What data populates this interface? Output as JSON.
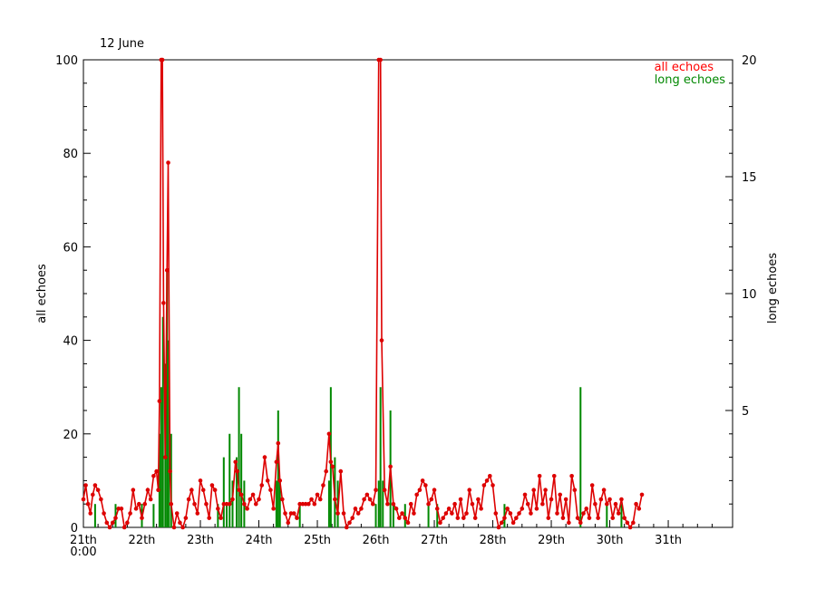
{
  "chart_data": {
    "type": "line",
    "title": "12 June",
    "ylabel_left": "all echoes",
    "ylabel_right": "long echoes",
    "ylim_left": [
      0,
      100
    ],
    "ylim_right": [
      0,
      20
    ],
    "xlim_days": [
      21,
      32.1
    ],
    "x_ticks": [
      {
        "day": 21,
        "label": "21th",
        "sublabel": "0:00"
      },
      {
        "day": 22,
        "label": "22th"
      },
      {
        "day": 23,
        "label": "23th"
      },
      {
        "day": 24,
        "label": "24th"
      },
      {
        "day": 25,
        "label": "25th"
      },
      {
        "day": 26,
        "label": "26th"
      },
      {
        "day": 27,
        "label": "27th"
      },
      {
        "day": 28,
        "label": "28th"
      },
      {
        "day": 29,
        "label": "29th"
      },
      {
        "day": 30,
        "label": "30th"
      },
      {
        "day": 31,
        "label": "31th"
      }
    ],
    "y_ticks_left": [
      0,
      20,
      40,
      60,
      80,
      100
    ],
    "y_ticks_right": [
      5,
      10,
      15,
      20
    ],
    "legend": {
      "position": "top-right",
      "entries": [
        {
          "name": "all echoes",
          "color": "#ff0000"
        },
        {
          "name": "long echoes",
          "color": "#008800"
        }
      ]
    },
    "series": [
      {
        "name": "all echoes",
        "axis": "left",
        "color": "#dd0000",
        "points": [
          [
            21.0,
            6
          ],
          [
            21.04,
            9
          ],
          [
            21.08,
            5
          ],
          [
            21.12,
            3
          ],
          [
            21.16,
            7
          ],
          [
            21.2,
            9
          ],
          [
            21.25,
            8
          ],
          [
            21.3,
            6
          ],
          [
            21.35,
            3
          ],
          [
            21.4,
            1
          ],
          [
            21.45,
            0
          ],
          [
            21.5,
            1
          ],
          [
            21.55,
            2
          ],
          [
            21.6,
            4
          ],
          [
            21.65,
            4
          ],
          [
            21.7,
            0
          ],
          [
            21.75,
            1
          ],
          [
            21.8,
            3
          ],
          [
            21.85,
            8
          ],
          [
            21.9,
            4
          ],
          [
            21.95,
            5
          ],
          [
            22.0,
            2
          ],
          [
            22.05,
            5
          ],
          [
            22.1,
            8
          ],
          [
            22.15,
            6
          ],
          [
            22.2,
            11
          ],
          [
            22.25,
            12
          ],
          [
            22.28,
            8
          ],
          [
            22.3,
            27
          ],
          [
            22.33,
            100
          ],
          [
            22.35,
            100
          ],
          [
            22.37,
            48
          ],
          [
            22.4,
            15
          ],
          [
            22.43,
            55
          ],
          [
            22.45,
            78
          ],
          [
            22.48,
            12
          ],
          [
            22.5,
            5
          ],
          [
            22.55,
            0
          ],
          [
            22.6,
            3
          ],
          [
            22.65,
            1
          ],
          [
            22.7,
            0
          ],
          [
            22.75,
            2
          ],
          [
            22.8,
            6
          ],
          [
            22.85,
            8
          ],
          [
            22.9,
            5
          ],
          [
            22.95,
            3
          ],
          [
            23.0,
            10
          ],
          [
            23.05,
            8
          ],
          [
            23.1,
            5
          ],
          [
            23.15,
            2
          ],
          [
            23.2,
            9
          ],
          [
            23.25,
            8
          ],
          [
            23.3,
            4
          ],
          [
            23.35,
            2
          ],
          [
            23.4,
            5
          ],
          [
            23.45,
            5
          ],
          [
            23.5,
            5
          ],
          [
            23.55,
            6
          ],
          [
            23.6,
            14
          ],
          [
            23.63,
            12
          ],
          [
            23.66,
            8
          ],
          [
            23.7,
            7
          ],
          [
            23.75,
            5
          ],
          [
            23.8,
            4
          ],
          [
            23.85,
            6
          ],
          [
            23.9,
            7
          ],
          [
            23.95,
            5
          ],
          [
            24.0,
            6
          ],
          [
            24.05,
            9
          ],
          [
            24.1,
            15
          ],
          [
            24.15,
            10
          ],
          [
            24.2,
            8
          ],
          [
            24.25,
            4
          ],
          [
            24.3,
            14
          ],
          [
            24.33,
            18
          ],
          [
            24.36,
            10
          ],
          [
            24.4,
            6
          ],
          [
            24.45,
            3
          ],
          [
            24.5,
            1
          ],
          [
            24.55,
            3
          ],
          [
            24.6,
            3
          ],
          [
            24.65,
            2
          ],
          [
            24.7,
            5
          ],
          [
            24.75,
            5
          ],
          [
            24.8,
            5
          ],
          [
            24.85,
            5
          ],
          [
            24.9,
            6
          ],
          [
            24.95,
            5
          ],
          [
            25.0,
            7
          ],
          [
            25.05,
            6
          ],
          [
            25.1,
            9
          ],
          [
            25.15,
            12
          ],
          [
            25.2,
            20
          ],
          [
            25.23,
            14
          ],
          [
            25.26,
            13
          ],
          [
            25.3,
            6
          ],
          [
            25.35,
            3
          ],
          [
            25.4,
            12
          ],
          [
            25.45,
            3
          ],
          [
            25.5,
            0
          ],
          [
            25.55,
            1
          ],
          [
            25.6,
            2
          ],
          [
            25.65,
            4
          ],
          [
            25.7,
            3
          ],
          [
            25.75,
            4
          ],
          [
            25.8,
            6
          ],
          [
            25.85,
            7
          ],
          [
            25.9,
            6
          ],
          [
            25.95,
            5
          ],
          [
            26.0,
            8
          ],
          [
            26.05,
            100
          ],
          [
            26.08,
            100
          ],
          [
            26.1,
            40
          ],
          [
            26.15,
            8
          ],
          [
            26.2,
            5
          ],
          [
            26.25,
            13
          ],
          [
            26.3,
            5
          ],
          [
            26.35,
            4
          ],
          [
            26.4,
            2
          ],
          [
            26.45,
            3
          ],
          [
            26.5,
            2
          ],
          [
            26.55,
            1
          ],
          [
            26.6,
            5
          ],
          [
            26.65,
            3
          ],
          [
            26.7,
            7
          ],
          [
            26.75,
            8
          ],
          [
            26.8,
            10
          ],
          [
            26.85,
            9
          ],
          [
            26.9,
            5
          ],
          [
            26.95,
            6
          ],
          [
            27.0,
            8
          ],
          [
            27.05,
            4
          ],
          [
            27.1,
            1
          ],
          [
            27.15,
            2
          ],
          [
            27.2,
            3
          ],
          [
            27.25,
            4
          ],
          [
            27.3,
            3
          ],
          [
            27.35,
            5
          ],
          [
            27.4,
            2
          ],
          [
            27.45,
            6
          ],
          [
            27.5,
            2
          ],
          [
            27.55,
            3
          ],
          [
            27.6,
            8
          ],
          [
            27.65,
            5
          ],
          [
            27.7,
            2
          ],
          [
            27.75,
            6
          ],
          [
            27.8,
            4
          ],
          [
            27.85,
            9
          ],
          [
            27.9,
            10
          ],
          [
            27.95,
            11
          ],
          [
            28.0,
            9
          ],
          [
            28.05,
            3
          ],
          [
            28.1,
            0
          ],
          [
            28.15,
            1
          ],
          [
            28.2,
            2
          ],
          [
            28.25,
            4
          ],
          [
            28.3,
            3
          ],
          [
            28.35,
            1
          ],
          [
            28.4,
            2
          ],
          [
            28.45,
            3
          ],
          [
            28.5,
            4
          ],
          [
            28.55,
            7
          ],
          [
            28.6,
            5
          ],
          [
            28.65,
            3
          ],
          [
            28.7,
            8
          ],
          [
            28.75,
            4
          ],
          [
            28.8,
            11
          ],
          [
            28.85,
            5
          ],
          [
            28.9,
            8
          ],
          [
            28.95,
            2
          ],
          [
            29.0,
            6
          ],
          [
            29.05,
            11
          ],
          [
            29.1,
            3
          ],
          [
            29.15,
            7
          ],
          [
            29.2,
            2
          ],
          [
            29.25,
            6
          ],
          [
            29.3,
            1
          ],
          [
            29.35,
            11
          ],
          [
            29.4,
            8
          ],
          [
            29.45,
            2
          ],
          [
            29.5,
            1
          ],
          [
            29.55,
            3
          ],
          [
            29.6,
            4
          ],
          [
            29.65,
            2
          ],
          [
            29.7,
            9
          ],
          [
            29.75,
            5
          ],
          [
            29.8,
            2
          ],
          [
            29.85,
            6
          ],
          [
            29.9,
            8
          ],
          [
            29.95,
            5
          ],
          [
            30.0,
            6
          ],
          [
            30.05,
            2
          ],
          [
            30.1,
            5
          ],
          [
            30.15,
            3
          ],
          [
            30.2,
            6
          ],
          [
            30.25,
            2
          ],
          [
            30.3,
            1
          ],
          [
            30.35,
            0
          ],
          [
            30.4,
            1
          ],
          [
            30.45,
            5
          ],
          [
            30.5,
            4
          ],
          [
            30.55,
            7
          ]
        ]
      },
      {
        "name": "long echoes",
        "axis": "right",
        "color": "#008800",
        "bars": [
          [
            21.2,
            1
          ],
          [
            21.55,
            1
          ],
          [
            22.0,
            1
          ],
          [
            22.2,
            1
          ],
          [
            22.3,
            4
          ],
          [
            22.33,
            6
          ],
          [
            22.36,
            9
          ],
          [
            22.4,
            7
          ],
          [
            22.43,
            11
          ],
          [
            22.46,
            8
          ],
          [
            22.5,
            4
          ],
          [
            23.3,
            1
          ],
          [
            23.4,
            3
          ],
          [
            23.45,
            1
          ],
          [
            23.5,
            4
          ],
          [
            23.55,
            2
          ],
          [
            23.62,
            3
          ],
          [
            23.66,
            6
          ],
          [
            23.7,
            4
          ],
          [
            23.75,
            2
          ],
          [
            24.3,
            2
          ],
          [
            24.33,
            5
          ],
          [
            24.36,
            2
          ],
          [
            24.7,
            1
          ],
          [
            25.2,
            2
          ],
          [
            25.23,
            6
          ],
          [
            25.3,
            3
          ],
          [
            25.35,
            2
          ],
          [
            26.0,
            1
          ],
          [
            26.05,
            2
          ],
          [
            26.08,
            6
          ],
          [
            26.12,
            2
          ],
          [
            26.25,
            5
          ],
          [
            26.3,
            1
          ],
          [
            26.5,
            1
          ],
          [
            26.9,
            1
          ],
          [
            27.05,
            1
          ],
          [
            28.2,
            1
          ],
          [
            29.5,
            6
          ],
          [
            29.95,
            1
          ],
          [
            30.2,
            1
          ]
        ]
      }
    ]
  }
}
